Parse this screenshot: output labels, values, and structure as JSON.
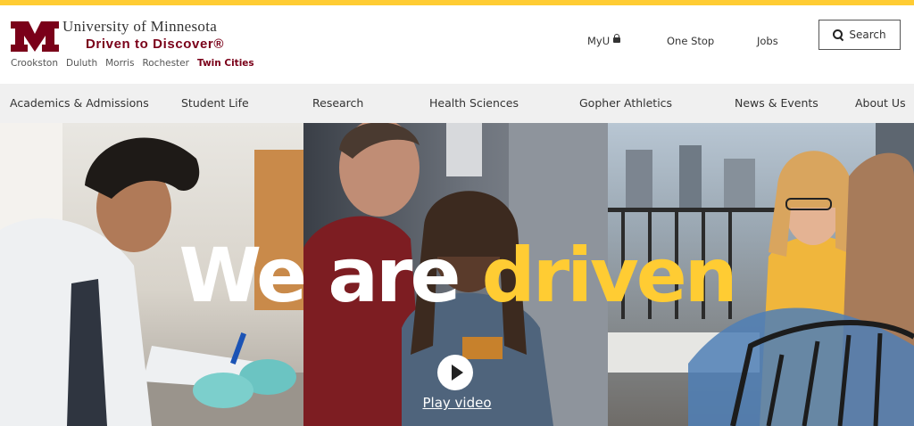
{
  "brand": {
    "university": "University of Minnesota",
    "tagline": "Driven to Discover®",
    "logo_icon": "block-m-logo",
    "colors": {
      "maroon": "#7a0019",
      "gold": "#ffcc33"
    }
  },
  "campuses": [
    "Crookston",
    "Duluth",
    "Morris",
    "Rochester",
    "Twin Cities"
  ],
  "active_campus": "Twin Cities",
  "utility_links": {
    "myu": "MyU",
    "one_stop": "One Stop",
    "jobs": "Jobs"
  },
  "search": {
    "label": "Search",
    "icon": "search-icon"
  },
  "nav": [
    "Academics & Admissions",
    "Student Life",
    "Research",
    "Health Sciences",
    "Gopher Athletics",
    "News & Events",
    "About Us"
  ],
  "hero": {
    "headline_white": "We are",
    "headline_gold": "driven",
    "play_label": "Play video",
    "play_icon": "play-icon"
  }
}
